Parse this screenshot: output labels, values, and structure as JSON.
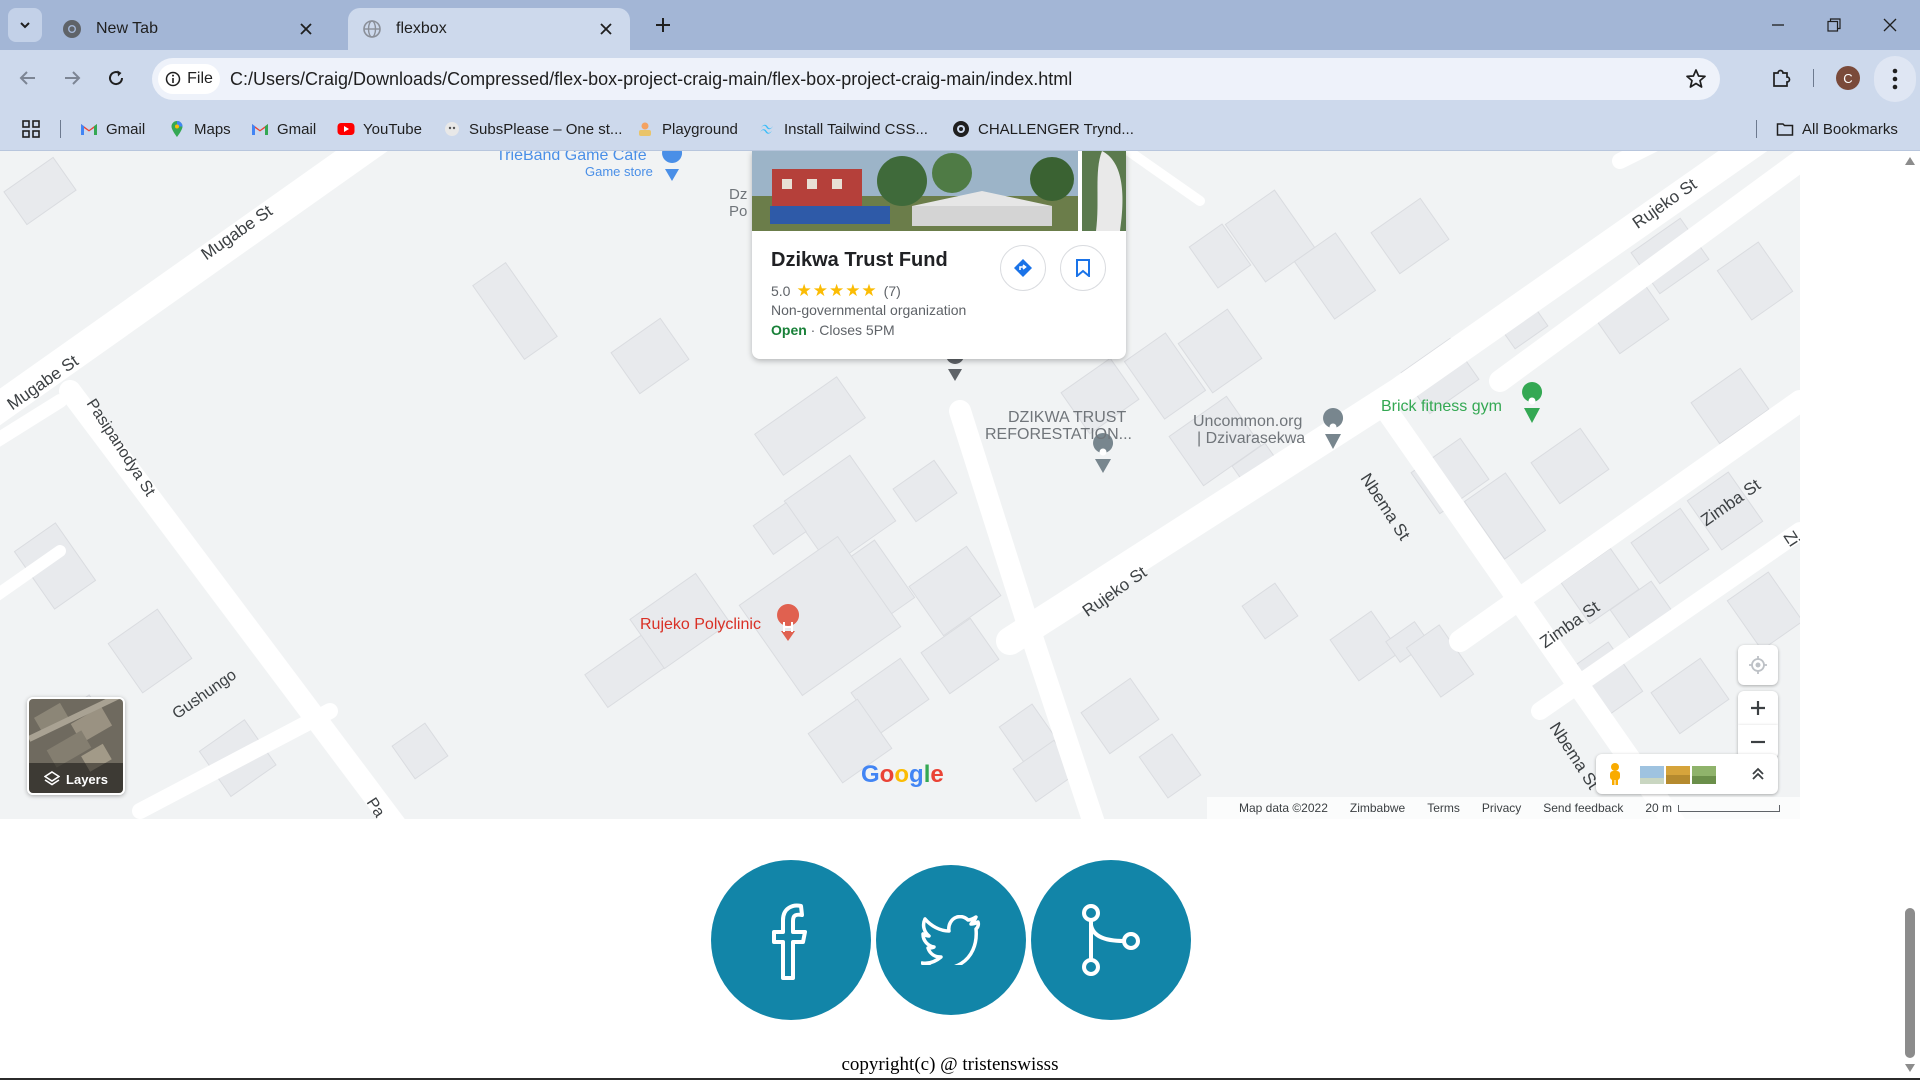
{
  "browser": {
    "tabs": [
      {
        "title": "New Tab",
        "favicon": "chrome-icon",
        "active": false
      },
      {
        "title": "flexbox",
        "favicon": "globe-icon",
        "active": true
      }
    ],
    "address": {
      "scheme_label": "File",
      "url": "C:/Users/Craig/Downloads/Compressed/flex-box-project-craig-main/flex-box-project-craig-main/index.html"
    },
    "profile_initial": "C",
    "bookmarks": [
      {
        "label": "Gmail",
        "icon": "gmail-icon"
      },
      {
        "label": "Maps",
        "icon": "maps-pin-icon"
      },
      {
        "label": "Gmail",
        "icon": "gmail-icon"
      },
      {
        "label": "YouTube",
        "icon": "youtube-icon"
      },
      {
        "label": "SubsPlease – One st...",
        "icon": "subsplease-icon"
      },
      {
        "label": "Playground",
        "icon": "playground-icon"
      },
      {
        "label": "Install Tailwind CSS...",
        "icon": "tailwind-icon"
      },
      {
        "label": "CHALLENGER Trynd...",
        "icon": "globe-icon"
      }
    ],
    "all_bookmarks": "All Bookmarks"
  },
  "map": {
    "streets": [
      "Mugabe St",
      "Mugabe St",
      "Pasipanodya St",
      "Gushungo",
      "Pa",
      "Rujeko St",
      "Rujeko St",
      "Nbema St",
      "Nbema St",
      "Zimba St",
      "Zimba St",
      "Zi"
    ],
    "places": {
      "game_cafe": "TrieBand Game Cafe",
      "game_cafe_type": "Game store",
      "dz_trunc_1": "Dz",
      "dz_trunc_2": "Po",
      "dzikwa_trust_line1": "DZIKWA TRUST",
      "dzikwa_trust_line2": "REFORESTATION...",
      "uncommon_line1": "Uncommon.org",
      "uncommon_line2": "| Dzivarasekwa",
      "brick_gym": "Brick fitness gym",
      "polyclinic": "Rujeko Polyclinic"
    },
    "info_card": {
      "name": "Dzikwa Trust Fund",
      "rating": "5.0",
      "stars": "★★★★★",
      "reviews": "(7)",
      "category": "Non-governmental organization",
      "open": "Open",
      "hours": "· Closes 5PM"
    },
    "layers_label": "Layers",
    "google_logo": [
      "G",
      "o",
      "o",
      "g",
      "l",
      "e"
    ],
    "attribution": {
      "map_data": "Map data ©2022",
      "region": "Zimbabwe",
      "terms": "Terms",
      "privacy": "Privacy",
      "feedback": "Send feedback",
      "scale": "20 m"
    }
  },
  "social": [
    {
      "name": "facebook",
      "icon": "facebook-icon"
    },
    {
      "name": "twitter",
      "icon": "twitter-icon"
    },
    {
      "name": "git",
      "icon": "git-branch-icon"
    }
  ],
  "footer": {
    "copyright": "copyright(c) @ tristenswisss"
  },
  "colors": {
    "social_bg": "#1285a8",
    "map_bg": "#f1f3f4",
    "browser_frame": "#a3b6d6",
    "toolbar": "#cdd9ec"
  }
}
